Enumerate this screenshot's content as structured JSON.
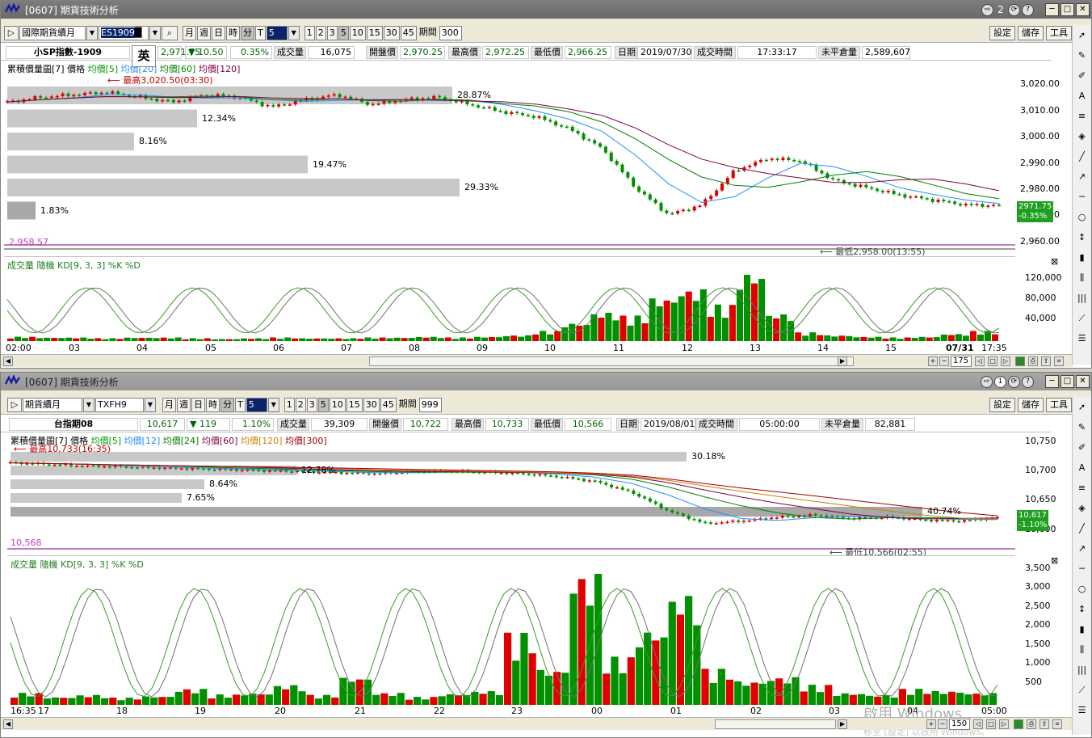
{
  "window1": {
    "title": "[0607] 期貨技術分析",
    "badge": "2",
    "toolbar": {
      "market": "國際期貨續月",
      "symbol": "ES1909",
      "periods": [
        "月",
        "週",
        "日",
        "時",
        "分",
        "T"
      ],
      "period_selected": "分",
      "minutes": "5",
      "multipliers": [
        "1",
        "2",
        "3",
        "5",
        "10",
        "15",
        "30",
        "45"
      ],
      "multiplier_selected": "5",
      "span_label": "期間",
      "span_value": "300",
      "right_buttons": [
        "設定",
        "儲存",
        "工具"
      ]
    },
    "quote": {
      "name": "小SP指數-1909",
      "price": "2,971.75",
      "change": "10.50",
      "change_pct": "0.35%",
      "volume_label": "成交量",
      "volume": "16,075",
      "open_label": "開盤價",
      "open": "2,970.25",
      "high_label": "最高價",
      "high": "2,972.25",
      "low_label": "最低價",
      "low": "2,966.25",
      "date_label": "日期",
      "date": "2019/07/30",
      "time_label": "成交時間",
      "time": "17:33:17",
      "oi_label": "未平倉量",
      "oi": "2,589,607"
    },
    "ime": "英",
    "price_pane": {
      "title_main": "累積價量圖[7] 價格",
      "ma": [
        {
          "label": "均價[5]",
          "color": "#00a000"
        },
        {
          "label": "均價[20]",
          "color": "#1e90ff"
        },
        {
          "label": "均價[60]",
          "color": "#008000"
        },
        {
          "label": "均價[120]",
          "color": "#800040"
        }
      ],
      "high_note": "最高3,020.50(03:30)",
      "low_note": "最低2,958.00(13:55)",
      "left_low": "2,958.57",
      "profile_bars": [
        {
          "pct": "28.87%",
          "w": 0.44
        },
        {
          "pct": "12.34%",
          "w": 0.188
        },
        {
          "pct": "8.16%",
          "w": 0.125
        },
        {
          "pct": "19.47%",
          "w": 0.297
        },
        {
          "pct": "29.33%",
          "w": 0.447
        },
        {
          "pct": "1.83%",
          "w": 0.028
        }
      ],
      "y_ticks": [
        "3,020.00",
        "3,010.00",
        "3,000.00",
        "2,990.00",
        "2,980.00",
        "2,970.00",
        "2,960.00"
      ],
      "last_box_price": "2971.75",
      "last_box_pct": "-0.35%"
    },
    "volume_pane": {
      "title": "成交量 隨機 KD[9, 3, 3] %K %D",
      "y_ticks": [
        "120,000",
        "80,000",
        "40,000"
      ]
    },
    "x_labels": [
      "02:00",
      "03",
      "04",
      "05",
      "06",
      "07",
      "08",
      "09",
      "10",
      "11",
      "12",
      "13",
      "14",
      "15"
    ],
    "x_right_date": "07/31",
    "x_right_time": "17:35",
    "scroll_count": "175"
  },
  "window2": {
    "title": "[0607] 期貨技術分析",
    "badge": "1",
    "toolbar": {
      "market": "期貨續月",
      "symbol": "TXFH9",
      "periods": [
        "月",
        "週",
        "日",
        "時",
        "分",
        "T"
      ],
      "period_selected": "分",
      "minutes": "5",
      "multipliers": [
        "1",
        "2",
        "3",
        "5",
        "10",
        "15",
        "30",
        "45"
      ],
      "multiplier_selected": "5",
      "span_label": "期間",
      "span_value": "999",
      "right_buttons": [
        "設定",
        "儲存",
        "工具"
      ]
    },
    "quote": {
      "name": "台指期08",
      "price": "10,617",
      "change": "119",
      "change_pct": "1.10%",
      "volume_label": "成交量",
      "volume": "39,309",
      "open_label": "開盤價",
      "open": "10,722",
      "high_label": "最高價",
      "high": "10,733",
      "low_label": "最低價",
      "low": "10,566",
      "date_label": "日期",
      "date": "2019/08/01",
      "time_label": "成交時間",
      "time": "05:00:00",
      "oi_label": "未平倉量",
      "oi": "82,881"
    },
    "price_pane": {
      "title_main": "累積價量圖[7] 價格",
      "ma": [
        {
          "label": "均價[5]",
          "color": "#00a000"
        },
        {
          "label": "均價[12]",
          "color": "#1e90ff"
        },
        {
          "label": "均價[24]",
          "color": "#008000"
        },
        {
          "label": "均價[60]",
          "color": "#800040"
        },
        {
          "label": "均價[120]",
          "color": "#d08000"
        },
        {
          "label": "均價[300]",
          "color": "#a00000"
        }
      ],
      "high_note": "最高10,733(16:35)",
      "low_note": "最低10,566(02:55)",
      "left_low": "10,568",
      "profile_bars": [
        {
          "pct": "30.18%",
          "w": 0.671
        },
        {
          "pct": "12.78%",
          "w": 0.284
        },
        {
          "pct": "8.64%",
          "w": 0.192
        },
        {
          "pct": "7.65%",
          "w": 0.17
        },
        {
          "pct": "40.74%",
          "w": 0.905
        }
      ],
      "y_ticks": [
        "10,750",
        "10,700",
        "10,650",
        "10,600"
      ],
      "last_box_price": "10,617",
      "last_box_pct": "-1.10%"
    },
    "volume_pane": {
      "title": "成交量 隨機 KD[9, 3, 3] %K %D",
      "y_ticks": [
        "3,500",
        "3,000",
        "2,500",
        "2,000",
        "1,500",
        "1,000",
        "500"
      ]
    },
    "x_labels": [
      "16:35",
      "17",
      "18",
      "19",
      "20",
      "21",
      "22",
      "23",
      "00",
      "01",
      "02",
      "03",
      "04",
      "05:00"
    ],
    "scroll_count": "150",
    "watermark": "啟用 Windows",
    "watermark_sub": "移至 [設定] 以啟用 Windows。"
  },
  "colors": {
    "up": "#e00000",
    "down": "#009000",
    "profile": "#c8c8c8",
    "profile_dark": "#a8a8a8",
    "kd_k": "#3c9b28",
    "kd_d": "#707070",
    "kd_fill_top": "#ff8080",
    "kd_fill_bottom": "#2090e0",
    "annotation": "#d00000"
  },
  "chart_data": [
    {
      "type": "candlestick",
      "title": "小SP指數-1909",
      "x_tick_labels": [
        "02:00",
        "03",
        "04",
        "05",
        "06",
        "07",
        "08",
        "09",
        "10",
        "11",
        "12",
        "13",
        "14",
        "15"
      ],
      "ylim": [
        2955,
        3025
      ],
      "key_points": [
        {
          "label": "high",
          "value": 3020.5,
          "time": "03:30"
        },
        {
          "label": "low",
          "value": 2958.0,
          "time": "13:55"
        },
        {
          "label": "last",
          "value": 2971.75
        }
      ],
      "price_path": [
        3014,
        3016,
        3017,
        3018,
        3016,
        3014,
        3017,
        3016,
        3012,
        3015,
        3017,
        3013,
        3015,
        3016,
        3013,
        3010,
        3008,
        3003,
        2995,
        2979,
        2968,
        2972,
        2986,
        2991,
        2990,
        2982,
        2979,
        2976,
        2974,
        2972,
        2971.75
      ],
      "volume_bars": [
        6,
        5,
        5,
        4,
        5,
        5,
        4,
        3,
        4,
        5,
        4,
        4,
        5,
        5,
        6,
        5,
        6,
        8,
        14,
        25,
        40,
        35,
        60,
        72,
        50,
        95,
        38,
        12,
        8,
        6,
        5,
        6,
        10,
        14
      ],
      "volume_ylim": [
        0,
        140000
      ]
    },
    {
      "type": "candlestick",
      "title": "台指期08",
      "x_tick_labels": [
        "16:35",
        "17",
        "18",
        "19",
        "20",
        "21",
        "22",
        "23",
        "00",
        "01",
        "02",
        "03",
        "04",
        "05:00"
      ],
      "ylim": [
        10560,
        10760
      ],
      "key_points": [
        {
          "label": "high",
          "value": 10733,
          "time": "16:35"
        },
        {
          "label": "low",
          "value": 10566,
          "time": "02:55"
        },
        {
          "label": "last",
          "value": 10617
        }
      ],
      "price_path": [
        10728,
        10725,
        10722,
        10720,
        10718,
        10716,
        10714,
        10712,
        10710,
        10708,
        10706,
        10710,
        10711,
        10709,
        10706,
        10700,
        10690,
        10668,
        10630,
        10605,
        10610,
        10618,
        10622,
        10615,
        10618,
        10612,
        10610,
        10617
      ],
      "volume_bars": [
        300,
        200,
        250,
        180,
        220,
        400,
        260,
        300,
        500,
        250,
        700,
        300,
        200,
        280,
        350,
        1800,
        900,
        3300,
        1200,
        1900,
        2800,
        900,
        600,
        700,
        500,
        300,
        250,
        400,
        350,
        300
      ],
      "volume_ylim": [
        0,
        3600
      ]
    }
  ]
}
